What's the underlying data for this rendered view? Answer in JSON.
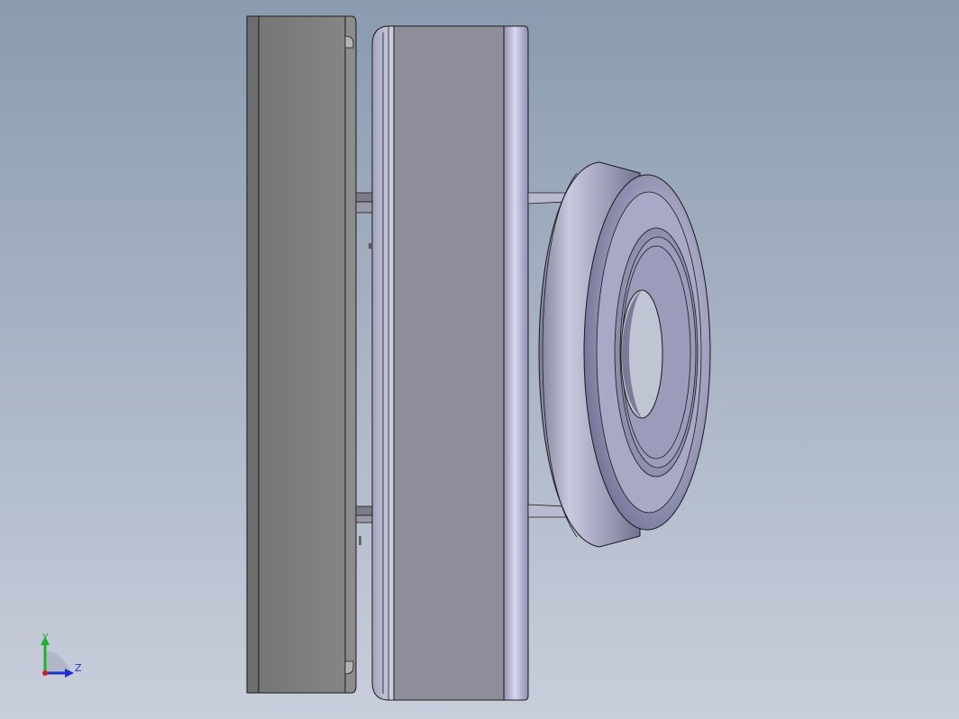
{
  "viewport": {
    "background_top": "#8a9bb0",
    "background_bottom": "#c9cedb"
  },
  "triad": {
    "y_label": "Y",
    "z_label": "Z",
    "y_color": "#20b030",
    "z_color": "#2030d0",
    "x_color": "#d02020"
  },
  "colors": {
    "left_plate": "#7b7b7b",
    "center_block": "#8e8d99",
    "flange": "#a8a8c8",
    "bearing": "#9a9ab8",
    "edge": "#1a1a1a"
  }
}
